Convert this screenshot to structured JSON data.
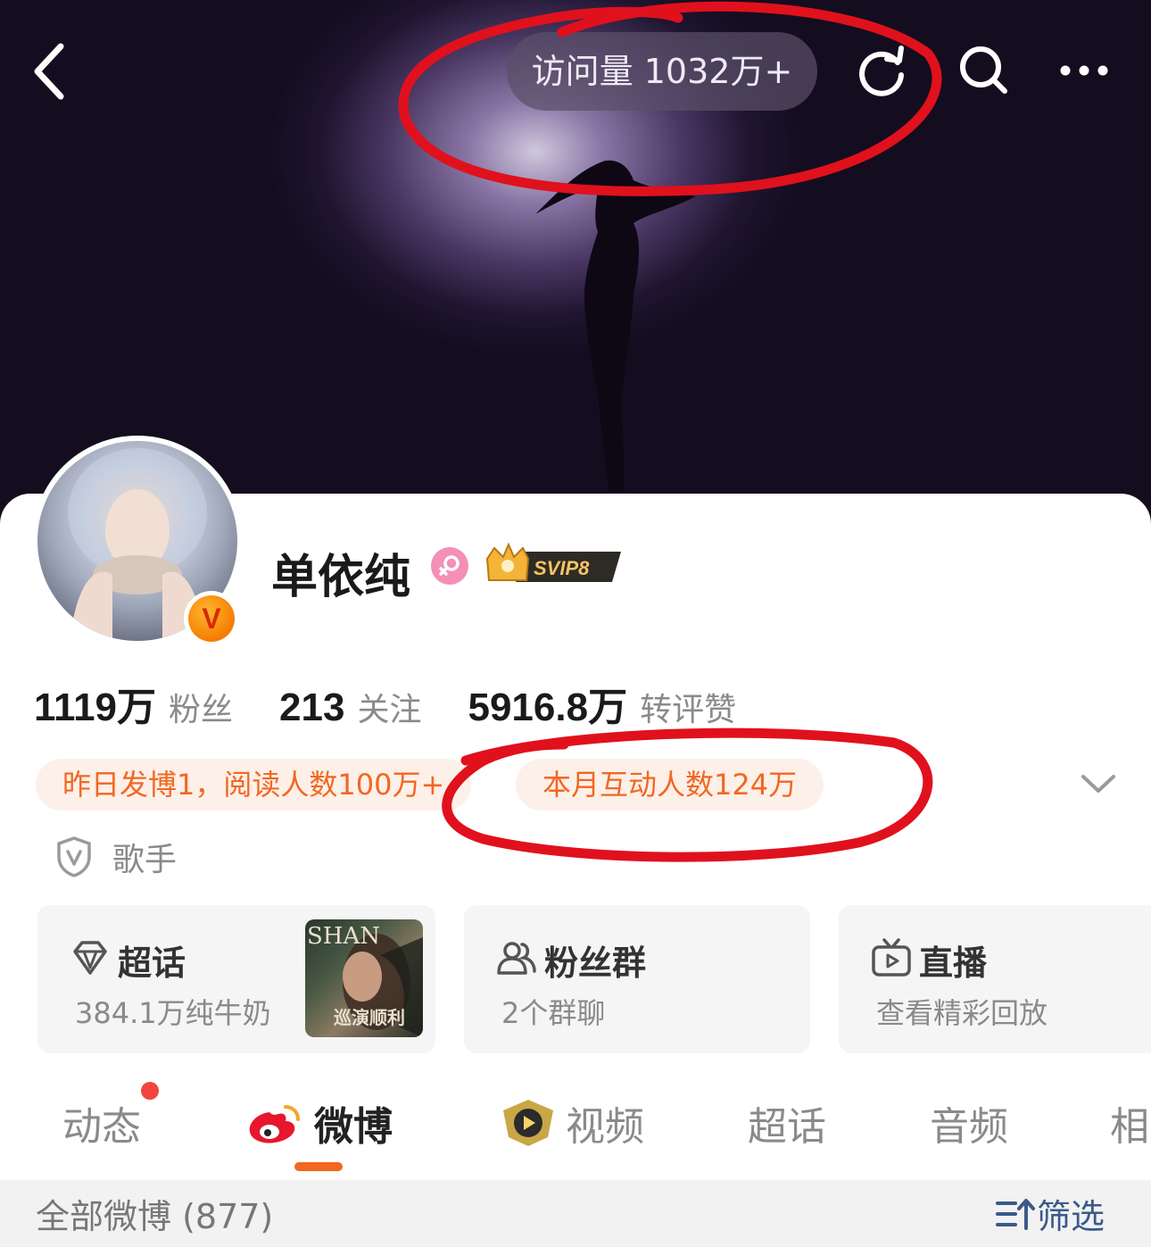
{
  "header": {
    "visit_label": "访问量 1032万+",
    "icons": [
      "back-icon",
      "refresh-icon",
      "search-icon",
      "more-icon"
    ]
  },
  "profile": {
    "name": "单依纯",
    "svip_label": "SVIP8",
    "verified_badge": "V",
    "stats": [
      {
        "value": "1119万",
        "label": "粉丝"
      },
      {
        "value": "213",
        "label": "关注"
      },
      {
        "value": "5916.8万",
        "label": "转评赞"
      }
    ],
    "chips": [
      "昨日发博1，阅读人数100万+",
      "本月互动人数124万"
    ],
    "tag": "歌手"
  },
  "tiles": [
    {
      "title": "超话",
      "subtitle": "384.1万纯牛奶",
      "icon": "diamond-icon"
    },
    {
      "title": "粉丝群",
      "subtitle": "2个群聊",
      "icon": "group-icon"
    },
    {
      "title": "直播",
      "subtitle": "查看精彩回放",
      "icon": "live-tv-icon"
    }
  ],
  "thumb": {
    "brand": "SHAN",
    "caption": "巡演顺利"
  },
  "tabs": [
    "动态",
    "微博",
    "视频",
    "超话",
    "音频",
    "相"
  ],
  "active_tab": "微博",
  "feed": {
    "count_label": "全部微博 (877)",
    "filter_label": "筛选"
  },
  "colors": {
    "accent": "#f26722",
    "annotation": "#e0111c",
    "chip_bg": "#fdf0e8"
  }
}
